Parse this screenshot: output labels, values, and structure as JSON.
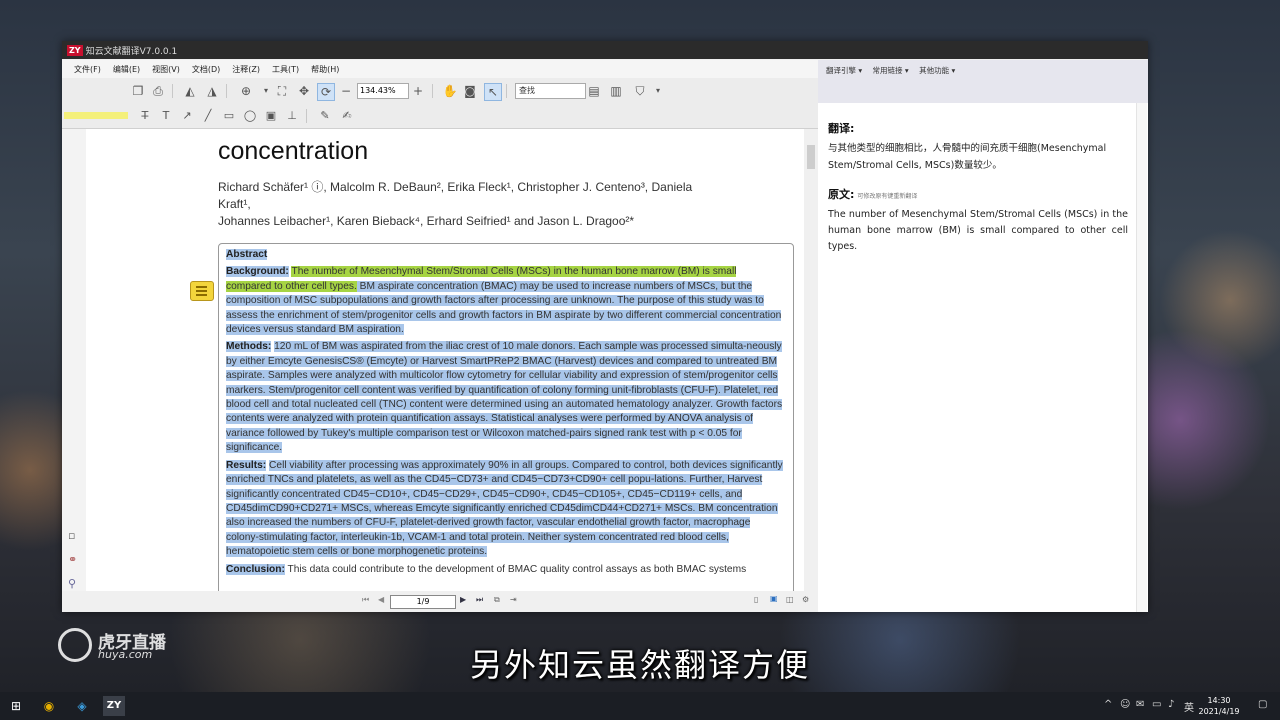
{
  "app": {
    "title": "知云文献翻译V7.0.0.1",
    "logo": "ZY"
  },
  "menu": [
    "文件(F)",
    "编辑(E)",
    "视图(V)",
    "文档(D)",
    "注释(Z)",
    "工具(T)",
    "帮助(H)"
  ],
  "toolbar": {
    "zoom": "134.43%",
    "find_placeholder": "查找"
  },
  "document": {
    "title_line": "concentration",
    "authors_line1": "Richard Schäfer¹ ⓘ, Malcolm R. DeBaun², Erika Fleck¹, Christopher J. Centeno³, Daniela Kraft¹,",
    "authors_line2": "Johannes Leibacher¹, Karen Bieback⁴, Erhard Seifried¹ and Jason L. Dragoo²*",
    "abstract": {
      "heading": "Abstract",
      "background_label": "Background:",
      "background_green": "The number of Mesenchymal Stem/Stromal Cells (MSCs) in the human bone marrow (BM) is small compared to other cell types.",
      "background_rest": " BM aspirate concentration (BMAC) may be used to increase numbers of MSCs, but the composition of MSC subpopulations and growth factors after processing are unknown. The purpose of this study was to assess the enrichment of stem/progenitor cells and growth factors in BM aspirate by two different commercial concentration devices versus standard BM aspiration.",
      "methods_label": "Methods:",
      "methods_text": "120 mL of BM was aspirated from the iliac crest of 10 male donors. Each sample was processed simulta-neously by either Emcyte GenesisCS® (Emcyte) or Harvest SmartPReP2 BMAC (Harvest) devices and compared to untreated BM aspirate. Samples were analyzed with multicolor flow cytometry for cellular viability and expression of stem/progenitor cells markers. Stem/progenitor cell content was verified by quantification of colony forming unit-fibroblasts (CFU-F). Platelet, red blood cell and total nucleated cell (TNC) content were determined using an automated hematology analyzer. Growth factors contents were analyzed with protein quantification assays. Statistical analyses were performed by ANOVA analysis of variance followed by Tukey's multiple comparison test or Wilcoxon matched-pairs signed rank test with p < 0.05 for significance.",
      "results_label": "Results:",
      "results_text": "Cell viability after processing was approximately 90% in all groups. Compared to control, both devices significantly enriched TNCs and platelets, as well as the CD45−CD73+ and CD45−CD73+CD90+ cell popu-lations. Further, Harvest significantly concentrated CD45−CD10+, CD45−CD29+, CD45−CD90+, CD45−CD105+, CD45−CD119+ cells, and CD45dimCD90+CD271+ MSCs, whereas Emcyte significantly enriched CD45dimCD44+CD271+ MSCs. BM concentration also increased the numbers of CFU-F, platelet-derived growth factor, vascular endothelial growth factor, macrophage colony-stimulating factor, interleukin-1b, VCAM-1 and total protein. Neither system concentrated red blood cells, hematopoietic stem cells or bone morphogenetic proteins.",
      "conclusion_label": "Conclusion:",
      "conclusion_text": "This data could contribute to the development of BMAC quality control assays as both BMAC systems"
    },
    "page": "1/9"
  },
  "right_panel": {
    "menu": [
      "翻译引擎 ▾",
      "常用链接 ▾",
      "其他功能 ▾"
    ],
    "translation_label": "翻译:",
    "translation_text": "与其他类型的细胞相比，人骨髓中的间充质干细胞(Mesenchymal Stem/Stromal Cells, MSCs)数量较少。",
    "original_label": "原文:",
    "original_hint": "可修改原有键重新翻译",
    "original_text": "The number of Mesenchymal Stem/Stromal Cells (MSCs) in the human bone marrow (BM) is small compared to other cell types."
  },
  "overlay": {
    "subtitle": "另外知云虽然翻译方便",
    "watermark_title": "虎牙直播",
    "watermark_sub": "huya.com"
  },
  "taskbar": {
    "time": "14:30",
    "date": "2021/4/19",
    "ime": "英",
    "zy_label": "ZY"
  },
  "colors": {
    "selection": "#a9c6ea",
    "highlight_green": "#a6d443",
    "note_yellow": "#f3d53c"
  }
}
